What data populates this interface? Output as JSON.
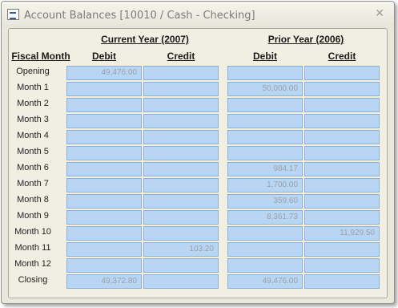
{
  "window": {
    "title": "Account Balances [10010 / Cash - Checking]"
  },
  "groups": [
    {
      "label": "Current Year (2007)"
    },
    {
      "label": "Prior Year (2006)"
    }
  ],
  "row_header": "Fiscal Month",
  "column_headers": [
    "Debit",
    "Credit",
    "Debit",
    "Credit"
  ],
  "rows": [
    {
      "label": "Opening",
      "values": [
        "49,476.00",
        "",
        "",
        ""
      ]
    },
    {
      "label": "Month 1",
      "values": [
        "",
        "",
        "50,000.00",
        ""
      ]
    },
    {
      "label": "Month 2",
      "values": [
        "",
        "",
        "",
        ""
      ]
    },
    {
      "label": "Month 3",
      "values": [
        "",
        "",
        "",
        ""
      ]
    },
    {
      "label": "Month 4",
      "values": [
        "",
        "",
        "",
        ""
      ]
    },
    {
      "label": "Month 5",
      "values": [
        "",
        "",
        "",
        ""
      ]
    },
    {
      "label": "Month 6",
      "values": [
        "",
        "",
        "984.17",
        ""
      ]
    },
    {
      "label": "Month 7",
      "values": [
        "",
        "",
        "1,700.00",
        ""
      ]
    },
    {
      "label": "Month 8",
      "values": [
        "",
        "",
        "359.60",
        ""
      ]
    },
    {
      "label": "Month 9",
      "values": [
        "",
        "",
        "8,361.73",
        ""
      ]
    },
    {
      "label": "Month 10",
      "values": [
        "",
        "",
        "",
        "11,929.50"
      ]
    },
    {
      "label": "Month 11",
      "values": [
        "",
        "103.20",
        "",
        ""
      ]
    },
    {
      "label": "Month 12",
      "values": [
        "",
        "",
        "",
        ""
      ]
    },
    {
      "label": "Closing",
      "values": [
        "49,372.80",
        "",
        "49,476.00",
        ""
      ]
    }
  ],
  "colors": {
    "cell_fill": "#b8d6f4",
    "cell_border": "#8ab0d8",
    "panel": "#f1efe2"
  }
}
